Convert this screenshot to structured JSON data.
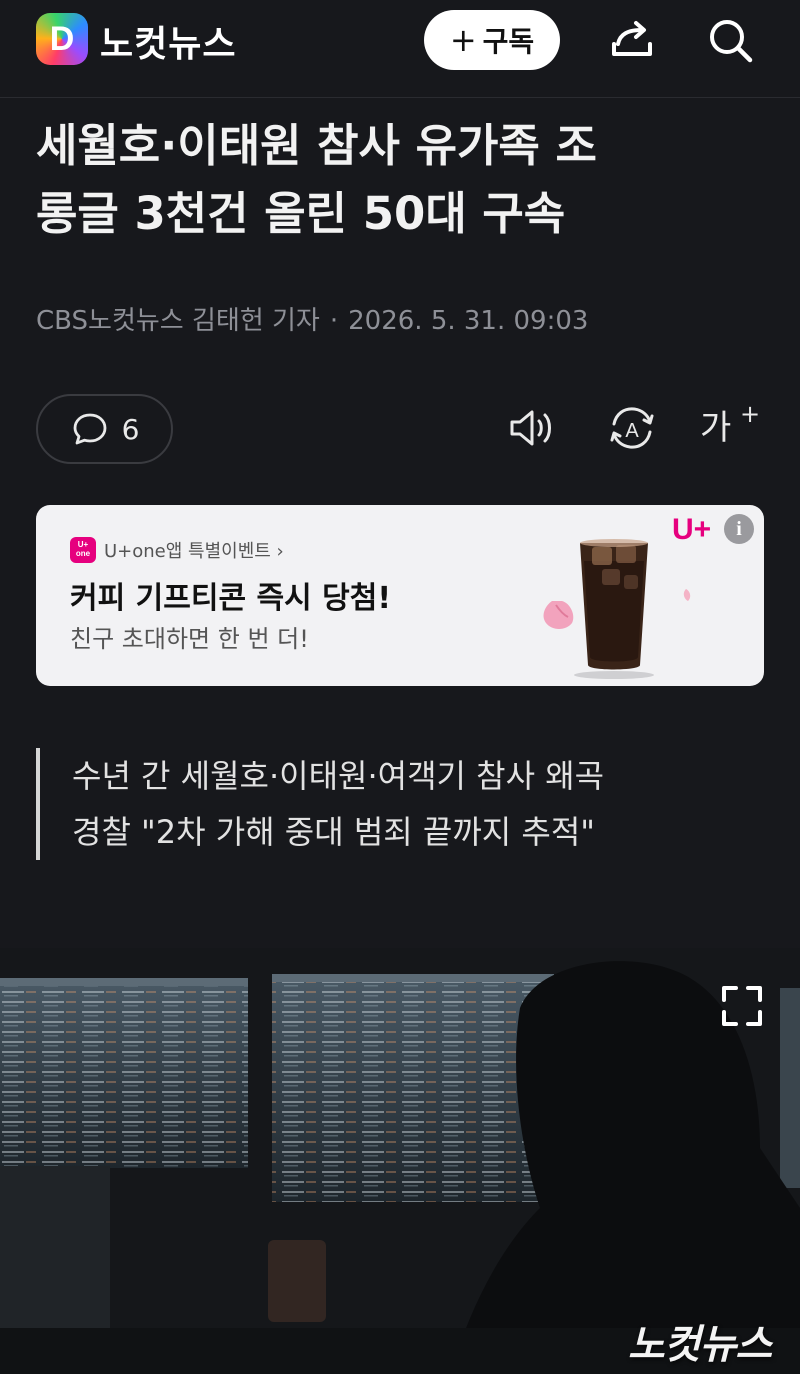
{
  "header": {
    "logo_letter": "D",
    "brand_name": "노컷뉴스",
    "subscribe_plus": "+",
    "subscribe_label": "구독"
  },
  "article": {
    "headline_line1": "세월호·이태원 참사 유가족 조",
    "headline_line2": "롱글 3천건 올린 50대 구속",
    "byline_source": "CBS노컷뉴스 김태헌 기자",
    "byline_separator": "·",
    "byline_date": "2026. 5. 31. 09:03",
    "comment_count": "6",
    "font_size_label": "가"
  },
  "ad": {
    "badge_top": "U+",
    "badge_bottom": "one",
    "source": "U+one앱 특별이벤트 ›",
    "title": "커피 기프티콘 즉시 당첨!",
    "subtitle": "친구 초대하면 한 번 더!",
    "brand": "U+",
    "info": "i",
    "brand_color": "#e6007e"
  },
  "summary": {
    "line1": "수년 간 세월호·이태원·여객기 참사 왜곡",
    "line2": "경찰 \"2차 가해 중대 범죄 끝까지 추적\""
  },
  "photo": {
    "watermark": "노컷뉴스"
  },
  "icons": {
    "share": "share-icon",
    "search": "search-icon",
    "comment": "comment-icon",
    "speaker": "speaker-icon",
    "translate": "translate-icon",
    "font_size": "font-size-icon",
    "fullscreen": "fullscreen-icon"
  }
}
